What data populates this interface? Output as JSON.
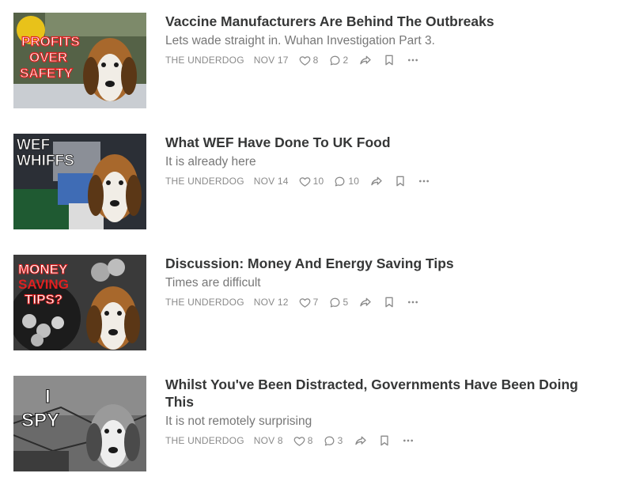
{
  "posts": [
    {
      "title": "Vaccine Manufacturers Are Behind The Outbreaks",
      "subtitle": "Lets wade straight in. Wuhan Investigation Part 3.",
      "author": "THE UNDERDOG",
      "date": "NOV 17",
      "likes": "8",
      "comments": "2",
      "thumb_text": [
        "PROFITS",
        "OVER",
        "SAFETY"
      ],
      "thumb_bg": "#5e6b52"
    },
    {
      "title": "What WEF Have Done To UK Food",
      "subtitle": "It is already here",
      "author": "THE UNDERDOG",
      "date": "NOV 14",
      "likes": "10",
      "comments": "10",
      "thumb_text": [
        "WEF",
        "WHIFFS"
      ],
      "thumb_bg": "#2b2f36"
    },
    {
      "title": "Discussion: Money And Energy Saving Tips",
      "subtitle": "Times are difficult",
      "author": "THE UNDERDOG",
      "date": "NOV 12",
      "likes": "7",
      "comments": "5",
      "thumb_text": [
        "MONEY",
        "SAVING",
        "TIPS?"
      ],
      "thumb_bg": "#3a3a3a"
    },
    {
      "title": "Whilst You've Been Distracted, Governments Have Been Doing This",
      "subtitle": "It is not remotely surprising",
      "author": "THE UNDERDOG",
      "date": "NOV 8",
      "likes": "8",
      "comments": "3",
      "thumb_text": [
        "I",
        "SPY"
      ],
      "thumb_bg": "#6a6a6a"
    }
  ],
  "icons": {
    "like": "heart-icon",
    "comment": "comment-bubble-icon",
    "share": "share-arrow-icon",
    "bookmark": "bookmark-icon",
    "more": "more-dots-icon"
  },
  "colors": {
    "title": "#363737",
    "subtitle": "#777777",
    "meta": "#8a8a8a",
    "text_red": "#e02020"
  }
}
